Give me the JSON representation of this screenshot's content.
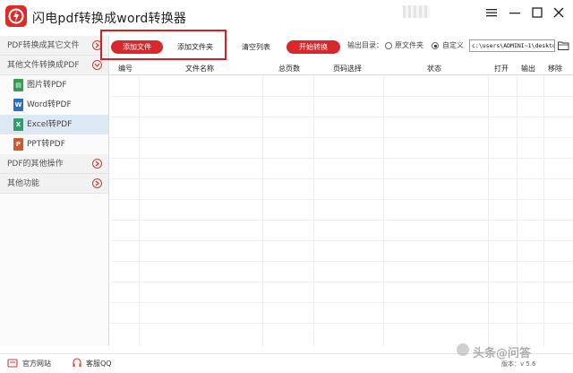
{
  "app": {
    "title": "闪电pdf转换成word转换器"
  },
  "window_controls": {
    "menu": "≡",
    "minimize": "—",
    "maximize": "☐",
    "close": "✕"
  },
  "sidebar": {
    "sections": [
      {
        "label": "PDF转换成其它文件"
      },
      {
        "label": "其他文件转换成PDF"
      },
      {
        "label": "PDF的其他操作"
      },
      {
        "label": "其他功能"
      }
    ],
    "items": [
      {
        "label": "图片转PDF",
        "icon_letter": "▤",
        "color": "#2e9e4f"
      },
      {
        "label": "Word转PDF",
        "icon_letter": "W",
        "color": "#2b6cc4"
      },
      {
        "label": "Excel转PDF",
        "icon_letter": "X",
        "color": "#2ca06a"
      },
      {
        "label": "PPT转PDF",
        "icon_letter": "P",
        "color": "#d2582c"
      }
    ],
    "active_item": "Excel转PDF"
  },
  "toolbar": {
    "add_file": "添加文件",
    "add_folder": "添加文件夹",
    "clear_list": "清空列表",
    "start_convert": "开始转换",
    "output_dir_label": "输出目录：",
    "option_original": "原文件夹",
    "option_custom": "自定义",
    "selected_option": "自定义",
    "path_value": "c:\\users\\ADMINI~1\\desktop"
  },
  "table": {
    "columns": [
      "编号",
      "文件名称",
      "总页数",
      "页码选择",
      "状态",
      "打开",
      "输出",
      "移除"
    ],
    "rows": []
  },
  "bottom": {
    "website": "官方网站",
    "qq": "客服QQ",
    "version": "版本：v 5.6"
  },
  "watermark": "头条@问答",
  "colors": {
    "accent_red": "#d9282c",
    "highlight_box": "#d71f1f",
    "active_bg": "#dde8f5"
  }
}
